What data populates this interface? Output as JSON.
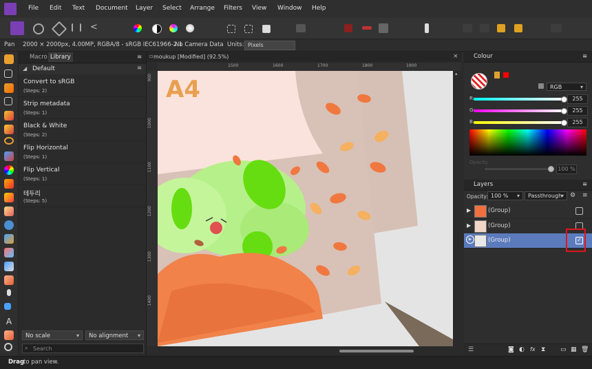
{
  "menu": [
    "File",
    "Edit",
    "Text",
    "Document",
    "Layer",
    "Select",
    "Arrange",
    "Filters",
    "View",
    "Window",
    "Help"
  ],
  "context": {
    "tool": "Pan",
    "doc_info": "2000 × 2000px, 4.00MP, RGBA/8 - sRGB IEC61966-2.1",
    "camera": "No Camera Data",
    "units_label": "Units:",
    "units_value": "Pixels"
  },
  "library": {
    "tabs": [
      "Macro",
      "Library"
    ],
    "category": "Default",
    "macros": [
      {
        "name": "Convert to sRGB",
        "steps": "(Steps: 2)"
      },
      {
        "name": "Strip metadata",
        "steps": "(Steps: 1)"
      },
      {
        "name": "Black & White",
        "steps": "(Steps: 2)"
      },
      {
        "name": "Flip Horizontal",
        "steps": "(Steps: 1)"
      },
      {
        "name": "Flip Vertical",
        "steps": "(Steps: 1)"
      },
      {
        "name": "테두리",
        "steps": "(Steps: 5)"
      }
    ],
    "scale": "No scale",
    "alignment": "No alignment",
    "search_placeholder": "Search"
  },
  "document": {
    "tab_title": "moukup [Modified] (92.5%)",
    "ruler_top": [
      "1500",
      "1600",
      "1700",
      "1800",
      "1900"
    ],
    "ruler_left": [
      "900",
      "1000",
      "1100",
      "1200",
      "1300",
      "1400"
    ],
    "artwork_text": "A4"
  },
  "colour": {
    "title": "Colour",
    "model": "RGB",
    "r_label": "R:",
    "g_label": "G:",
    "b_label": "B:",
    "r": "255",
    "g": "255",
    "b": "255",
    "opacity_label": "Opacity",
    "opacity": "100 %",
    "swatch": "#ff0000"
  },
  "layers": {
    "title": "Layers",
    "opacity_label": "Opacity:",
    "opacity": "100 %",
    "blend": "Passthrough",
    "items": [
      {
        "name": "(Group)",
        "visible": false
      },
      {
        "name": "(Group)",
        "visible": false
      },
      {
        "name": "(Group)",
        "visible": true
      }
    ]
  },
  "status": {
    "bold": "Drag",
    "rest": "to pan view."
  },
  "colors": {
    "accent": "#7b3fb5",
    "selected_layer": "#5b7bbd",
    "highlight": "#e0151b"
  }
}
